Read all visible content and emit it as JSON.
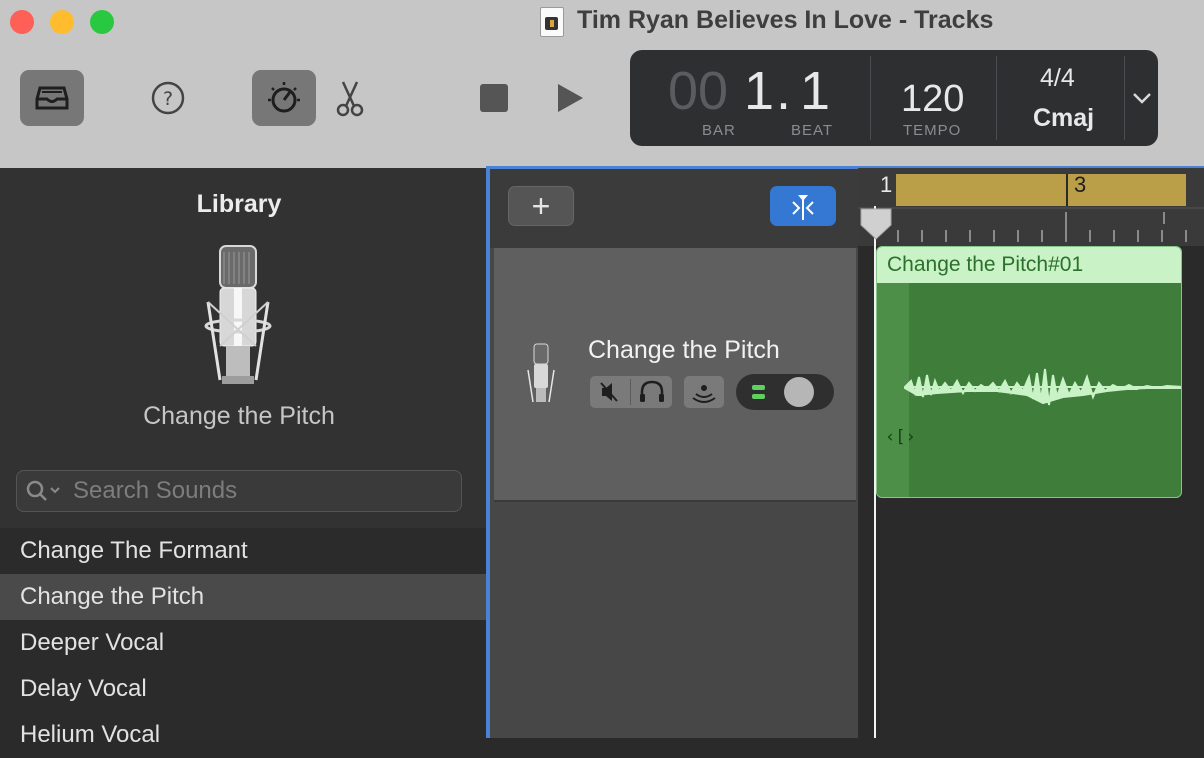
{
  "window": {
    "title": "Tim Ryan Believes In Love - Tracks",
    "traffic_colors": {
      "close": "#fe5f57",
      "minimize": "#febc2e",
      "zoom": "#28c840"
    }
  },
  "toolbar": {
    "icons": [
      "library-icon",
      "help-icon",
      "smart-controls-icon",
      "editors-icon",
      "stop-icon",
      "play-icon"
    ]
  },
  "lcd": {
    "bar_dim": "00",
    "bar_value": "1",
    "beat_value": "1",
    "bar_label": "BAR",
    "beat_label": "BEAT",
    "tempo": "120",
    "tempo_label": "TEMPO",
    "signature": "4/4",
    "key": "Cmaj"
  },
  "library": {
    "title": "Library",
    "selected_sound": "Change the Pitch",
    "search_placeholder": "Search Sounds",
    "items": [
      {
        "label": "Change The Formant",
        "selected": false
      },
      {
        "label": "Change the Pitch",
        "selected": true
      },
      {
        "label": "Deeper Vocal",
        "selected": false
      },
      {
        "label": "Delay Vocal",
        "selected": false
      },
      {
        "label": "Helium Vocal",
        "selected": false
      }
    ]
  },
  "tracks": {
    "add_label": "+",
    "track_name": "Change the Pitch",
    "ruler_labels": [
      "1",
      "3"
    ],
    "region_name": "Change the Pitch#01",
    "colors": {
      "region": "#3f7d3a",
      "region_header": "#c9f3c6",
      "cycle": "#bb9f48",
      "accent": "#3478d4"
    }
  }
}
